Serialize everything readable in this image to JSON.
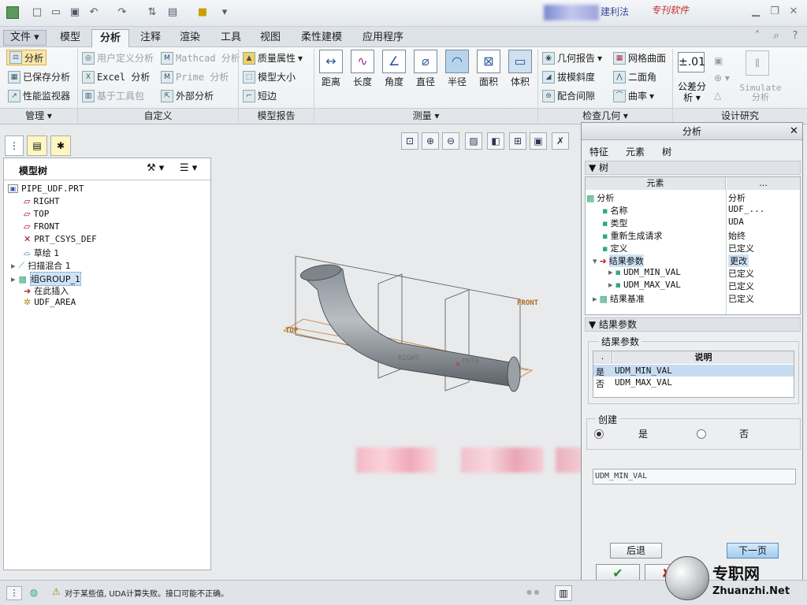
{
  "titlebar": {
    "app_title_1": "建利法",
    "app_title_2": "专刊软件"
  },
  "tabs": [
    "文件",
    "模型",
    "分析",
    "注释",
    "渲染",
    "工具",
    "视图",
    "柔性建模",
    "应用程序"
  ],
  "ribbon": {
    "manage": {
      "analysis": "分析",
      "saved": "已保存分析",
      "perf": "性能监视器",
      "group": "管理"
    },
    "custom": {
      "user_def": "用户定义分析",
      "excel": "Excel 分析",
      "toolkit": "基于工具包",
      "mathcad": "Mathcad 分析",
      "prime": "Prime 分析",
      "external": "外部分析",
      "group": "自定义"
    },
    "model_report": {
      "mass": "质量属性",
      "size": "模型大小",
      "short": "短边",
      "group": "模型报告"
    },
    "measure": {
      "distance": "距离",
      "length": "长度",
      "angle": "角度",
      "diameter": "直径",
      "radius": "半径",
      "area": "面积",
      "volume": "体积",
      "group": "测量"
    },
    "inspect": {
      "geom_report": "几何报告",
      "draft": "拔模斜度",
      "clearance": "配合间隙",
      "mesh": "网格曲面",
      "dihedral": "二面角",
      "curvature": "曲率",
      "group": "检查几何"
    },
    "design": {
      "tol_label": "±.01",
      "tol": "公差分析",
      "simulate_1": "Simulate",
      "simulate_2": "分析",
      "group": "设计研究"
    }
  },
  "model_tree": {
    "title": "模型树",
    "items": [
      "PIPE_UDF.PRT",
      "RIGHT",
      "TOP",
      "FRONT",
      "PRT_CSYS_DEF",
      "草绘 1",
      "扫描混合 1",
      "组GROUP_1",
      "在此插入",
      "UDF_AREA"
    ],
    "selected_index": 7
  },
  "viewport": {
    "label_front": "FRONT",
    "label_top": "TOP",
    "label_right": "RIGHT",
    "label_pnt": "PNT0"
  },
  "dialog": {
    "title": "分析",
    "tabs": [
      "特征",
      "元素",
      "树"
    ],
    "tree_section": "树",
    "col_element": "元素",
    "col_dots": "...",
    "rows": [
      {
        "name": "分析",
        "value": "分析"
      },
      {
        "name": "名称",
        "value": "UDF_..."
      },
      {
        "name": "类型",
        "value": "UDA"
      },
      {
        "name": "重新生成请求",
        "value": "始终"
      },
      {
        "name": "定义",
        "value": "已定义"
      },
      {
        "name": "结果参数",
        "value": "更改"
      },
      {
        "name": "UDM_MIN_VAL",
        "value": "已定义"
      },
      {
        "name": "UDM_MAX_VAL",
        "value": "已定义"
      },
      {
        "name": "结果基准",
        "value": "已定义"
      }
    ],
    "result_section": "结果参数",
    "result_group": "结果参数",
    "result_col_dot": ".",
    "result_col_desc": "说明",
    "result_rows": [
      {
        "flag": "是",
        "desc": "UDM_MIN_VAL"
      },
      {
        "flag": "否",
        "desc": "UDM_MAX_VAL"
      }
    ],
    "create_group": "创建",
    "radio_yes": "是",
    "radio_no": "否",
    "name_value": "UDM_MIN_VAL",
    "back_btn": "后退",
    "next_btn": "下一页",
    "ok_icon": "✔",
    "cancel_icon": "✘"
  },
  "status": {
    "message": "对于某些值, UDA计算失败。接口可能不正确。"
  },
  "watermark": {
    "cn": "专职网",
    "url": "Zhuanzhi.Net"
  }
}
